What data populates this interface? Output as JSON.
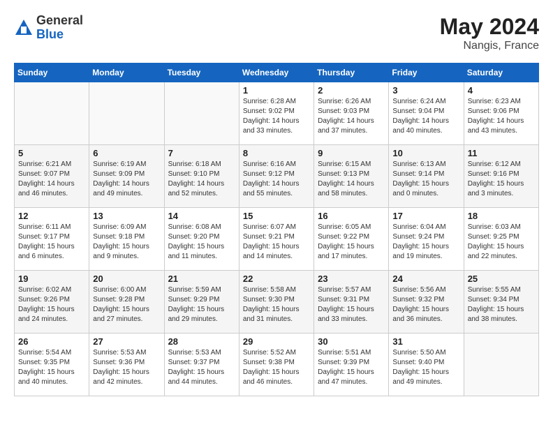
{
  "header": {
    "logo_general": "General",
    "logo_blue": "Blue",
    "month_year": "May 2024",
    "location": "Nangis, France"
  },
  "calendar": {
    "days_of_week": [
      "Sunday",
      "Monday",
      "Tuesday",
      "Wednesday",
      "Thursday",
      "Friday",
      "Saturday"
    ],
    "weeks": [
      [
        {
          "day": "",
          "info": ""
        },
        {
          "day": "",
          "info": ""
        },
        {
          "day": "",
          "info": ""
        },
        {
          "day": "1",
          "info": "Sunrise: 6:28 AM\nSunset: 9:02 PM\nDaylight: 14 hours\nand 33 minutes."
        },
        {
          "day": "2",
          "info": "Sunrise: 6:26 AM\nSunset: 9:03 PM\nDaylight: 14 hours\nand 37 minutes."
        },
        {
          "day": "3",
          "info": "Sunrise: 6:24 AM\nSunset: 9:04 PM\nDaylight: 14 hours\nand 40 minutes."
        },
        {
          "day": "4",
          "info": "Sunrise: 6:23 AM\nSunset: 9:06 PM\nDaylight: 14 hours\nand 43 minutes."
        }
      ],
      [
        {
          "day": "5",
          "info": "Sunrise: 6:21 AM\nSunset: 9:07 PM\nDaylight: 14 hours\nand 46 minutes."
        },
        {
          "day": "6",
          "info": "Sunrise: 6:19 AM\nSunset: 9:09 PM\nDaylight: 14 hours\nand 49 minutes."
        },
        {
          "day": "7",
          "info": "Sunrise: 6:18 AM\nSunset: 9:10 PM\nDaylight: 14 hours\nand 52 minutes."
        },
        {
          "day": "8",
          "info": "Sunrise: 6:16 AM\nSunset: 9:12 PM\nDaylight: 14 hours\nand 55 minutes."
        },
        {
          "day": "9",
          "info": "Sunrise: 6:15 AM\nSunset: 9:13 PM\nDaylight: 14 hours\nand 58 minutes."
        },
        {
          "day": "10",
          "info": "Sunrise: 6:13 AM\nSunset: 9:14 PM\nDaylight: 15 hours\nand 0 minutes."
        },
        {
          "day": "11",
          "info": "Sunrise: 6:12 AM\nSunset: 9:16 PM\nDaylight: 15 hours\nand 3 minutes."
        }
      ],
      [
        {
          "day": "12",
          "info": "Sunrise: 6:11 AM\nSunset: 9:17 PM\nDaylight: 15 hours\nand 6 minutes."
        },
        {
          "day": "13",
          "info": "Sunrise: 6:09 AM\nSunset: 9:18 PM\nDaylight: 15 hours\nand 9 minutes."
        },
        {
          "day": "14",
          "info": "Sunrise: 6:08 AM\nSunset: 9:20 PM\nDaylight: 15 hours\nand 11 minutes."
        },
        {
          "day": "15",
          "info": "Sunrise: 6:07 AM\nSunset: 9:21 PM\nDaylight: 15 hours\nand 14 minutes."
        },
        {
          "day": "16",
          "info": "Sunrise: 6:05 AM\nSunset: 9:22 PM\nDaylight: 15 hours\nand 17 minutes."
        },
        {
          "day": "17",
          "info": "Sunrise: 6:04 AM\nSunset: 9:24 PM\nDaylight: 15 hours\nand 19 minutes."
        },
        {
          "day": "18",
          "info": "Sunrise: 6:03 AM\nSunset: 9:25 PM\nDaylight: 15 hours\nand 22 minutes."
        }
      ],
      [
        {
          "day": "19",
          "info": "Sunrise: 6:02 AM\nSunset: 9:26 PM\nDaylight: 15 hours\nand 24 minutes."
        },
        {
          "day": "20",
          "info": "Sunrise: 6:00 AM\nSunset: 9:28 PM\nDaylight: 15 hours\nand 27 minutes."
        },
        {
          "day": "21",
          "info": "Sunrise: 5:59 AM\nSunset: 9:29 PM\nDaylight: 15 hours\nand 29 minutes."
        },
        {
          "day": "22",
          "info": "Sunrise: 5:58 AM\nSunset: 9:30 PM\nDaylight: 15 hours\nand 31 minutes."
        },
        {
          "day": "23",
          "info": "Sunrise: 5:57 AM\nSunset: 9:31 PM\nDaylight: 15 hours\nand 33 minutes."
        },
        {
          "day": "24",
          "info": "Sunrise: 5:56 AM\nSunset: 9:32 PM\nDaylight: 15 hours\nand 36 minutes."
        },
        {
          "day": "25",
          "info": "Sunrise: 5:55 AM\nSunset: 9:34 PM\nDaylight: 15 hours\nand 38 minutes."
        }
      ],
      [
        {
          "day": "26",
          "info": "Sunrise: 5:54 AM\nSunset: 9:35 PM\nDaylight: 15 hours\nand 40 minutes."
        },
        {
          "day": "27",
          "info": "Sunrise: 5:53 AM\nSunset: 9:36 PM\nDaylight: 15 hours\nand 42 minutes."
        },
        {
          "day": "28",
          "info": "Sunrise: 5:53 AM\nSunset: 9:37 PM\nDaylight: 15 hours\nand 44 minutes."
        },
        {
          "day": "29",
          "info": "Sunrise: 5:52 AM\nSunset: 9:38 PM\nDaylight: 15 hours\nand 46 minutes."
        },
        {
          "day": "30",
          "info": "Sunrise: 5:51 AM\nSunset: 9:39 PM\nDaylight: 15 hours\nand 47 minutes."
        },
        {
          "day": "31",
          "info": "Sunrise: 5:50 AM\nSunset: 9:40 PM\nDaylight: 15 hours\nand 49 minutes."
        },
        {
          "day": "",
          "info": ""
        }
      ]
    ]
  }
}
